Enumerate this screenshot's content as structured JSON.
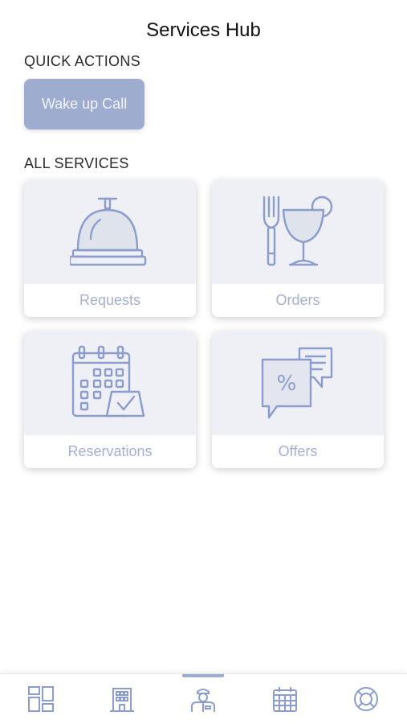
{
  "header": {
    "title": "Services Hub"
  },
  "quick_actions": {
    "label": "QUICK ACTIONS",
    "items": [
      {
        "label": "Wake up Call"
      }
    ]
  },
  "all_services": {
    "label": "ALL SERVICES",
    "items": [
      {
        "label": "Requests",
        "icon": "service-bell-icon"
      },
      {
        "label": "Orders",
        "icon": "fork-and-drink-icon"
      },
      {
        "label": "Reservations",
        "icon": "calendar-check-icon"
      },
      {
        "label": "Offers",
        "icon": "percent-chat-icon"
      }
    ]
  },
  "bottom_nav": {
    "items": [
      {
        "icon": "dashboard-icon",
        "active": false
      },
      {
        "icon": "hotel-building-icon",
        "active": false
      },
      {
        "icon": "concierge-icon",
        "active": true
      },
      {
        "icon": "calendar-icon",
        "active": false
      },
      {
        "icon": "lifebuoy-icon",
        "active": false
      }
    ]
  },
  "colors": {
    "accent": "#9daccf",
    "icon": "#8c9ccb",
    "card_label": "#a4b0d1"
  }
}
